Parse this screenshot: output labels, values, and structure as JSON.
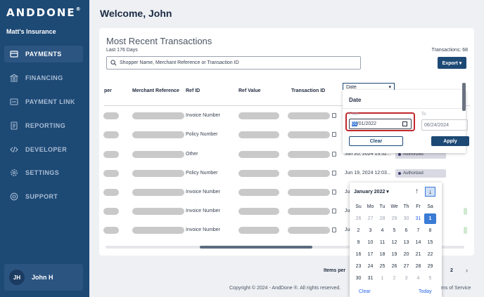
{
  "brand": {
    "logo": "ANDDONE",
    "reg": "®",
    "org_name": "Matt's Insurance"
  },
  "nav": [
    {
      "label": "PAYMENTS",
      "icon": "payments-icon",
      "active": true
    },
    {
      "label": "FINANCING",
      "icon": "bank-icon",
      "active": false
    },
    {
      "label": "PAYMENT LINK",
      "icon": "payment-link-icon",
      "active": false
    },
    {
      "label": "REPORTING",
      "icon": "reporting-icon",
      "active": false
    },
    {
      "label": "DEVELOPER",
      "icon": "code-icon",
      "active": false
    },
    {
      "label": "SETTINGS",
      "icon": "gear-icon",
      "active": false
    },
    {
      "label": "SUPPORT",
      "icon": "help-icon",
      "active": false
    }
  ],
  "user": {
    "initials": "JH",
    "name": "John H"
  },
  "page": {
    "welcome": "Welcome, John"
  },
  "transactions": {
    "title": "Most Recent Transactions",
    "subtitle": "Last 176 Days",
    "count_label": "Transactions: 68",
    "search_placeholder": "Shopper Name,  Merchant Reference or Transaction ID",
    "export_label": "Export ▾",
    "columns": [
      "per",
      "Merchant Reference",
      "Ref ID",
      "Ref Value",
      "Transaction ID",
      "Date"
    ],
    "rows": [
      {
        "ref_id": "Invoice Number",
        "date": "",
        "status": ""
      },
      {
        "ref_id": "Policy Number",
        "date": "",
        "status": ""
      },
      {
        "ref_id": "Other",
        "date": "Jun 20, 2024 13:52...",
        "status": "Authorized"
      },
      {
        "ref_id": "Policy Number",
        "date": "Jun 19, 2024 12:03...",
        "status": "Authorized"
      },
      {
        "ref_id": "Invoice Number",
        "date": "Ju",
        "status": ""
      },
      {
        "ref_id": "Invoice Number",
        "date": "Ju",
        "status": ""
      },
      {
        "ref_id": "Invoice Number",
        "date": "Ju",
        "status": ""
      }
    ]
  },
  "date_filter": {
    "column_label": "Date",
    "title": "Date",
    "from_label": "From",
    "to_label": "To",
    "from_month": "01",
    "from_rest": "/01/2022",
    "to_value": "06/24/2024",
    "clear_label": "Clear",
    "apply_label": "Apply"
  },
  "calendar": {
    "month_label": "January 2022 ▾",
    "weekdays": [
      "Su",
      "Mo",
      "Tu",
      "We",
      "Th",
      "Fr",
      "Sa"
    ],
    "weeks": [
      [
        "26",
        "27",
        "28",
        "29",
        "30",
        "31",
        "1"
      ],
      [
        "2",
        "3",
        "4",
        "5",
        "6",
        "7",
        "8"
      ],
      [
        "9",
        "10",
        "11",
        "12",
        "13",
        "14",
        "15"
      ],
      [
        "16",
        "17",
        "18",
        "19",
        "20",
        "21",
        "22"
      ],
      [
        "23",
        "24",
        "25",
        "26",
        "27",
        "28",
        "29"
      ],
      [
        "30",
        "31",
        "1",
        "2",
        "3",
        "4",
        "5"
      ]
    ],
    "selected": "1",
    "clear_label": "Clear",
    "today_label": "Today"
  },
  "footer": {
    "items_per_page": "Items per",
    "page": "2",
    "copyright": "Copyright © 2024 - AndDone ®. All rights reserved.",
    "terms": "ms of Service"
  }
}
